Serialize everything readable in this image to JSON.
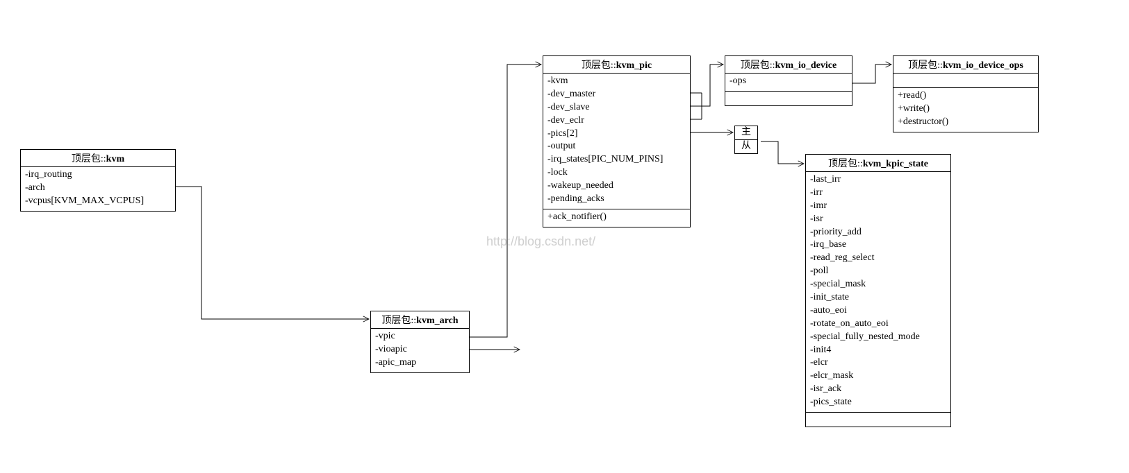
{
  "watermark": "http://blog.csdn.net/",
  "labels": {
    "pkg": "顶层包::",
    "master": "主",
    "slave": "从"
  },
  "classes": {
    "kvm": {
      "name": "kvm",
      "attrs": [
        "-irq_routing",
        "-arch",
        "-vcpus[KVM_MAX_VCPUS]"
      ],
      "ops": []
    },
    "kvm_arch": {
      "name": "kvm_arch",
      "attrs": [
        "-vpic",
        "-vioapic",
        "-apic_map"
      ],
      "ops": []
    },
    "kvm_pic": {
      "name": "kvm_pic",
      "attrs": [
        "-kvm",
        "-dev_master",
        "-dev_slave",
        "-dev_eclr",
        "-pics[2]",
        "-output",
        "-irq_states[PIC_NUM_PINS]",
        "-lock",
        "-wakeup_needed",
        "-pending_acks"
      ],
      "ops": [
        "+ack_notifier()"
      ]
    },
    "kvm_io_device": {
      "name": "kvm_io_device",
      "attrs": [
        "-ops"
      ],
      "ops": []
    },
    "kvm_io_device_ops": {
      "name": "kvm_io_device_ops",
      "attrs": [],
      "ops": [
        "+read()",
        "+write()",
        "+destructor()"
      ]
    },
    "kvm_kpic_state": {
      "name": "kvm_kpic_state",
      "attrs": [
        "-last_irr",
        "-irr",
        "-imr",
        "-isr",
        "-priority_add",
        "-irq_base",
        "-read_reg_select",
        "-poll",
        "-special_mask",
        "-init_state",
        "-auto_eoi",
        "-rotate_on_auto_eoi",
        "-special_fully_nested_mode",
        "-init4",
        "-elcr",
        "-elcr_mask",
        "-isr_ack",
        "-pics_state"
      ],
      "ops": []
    }
  }
}
